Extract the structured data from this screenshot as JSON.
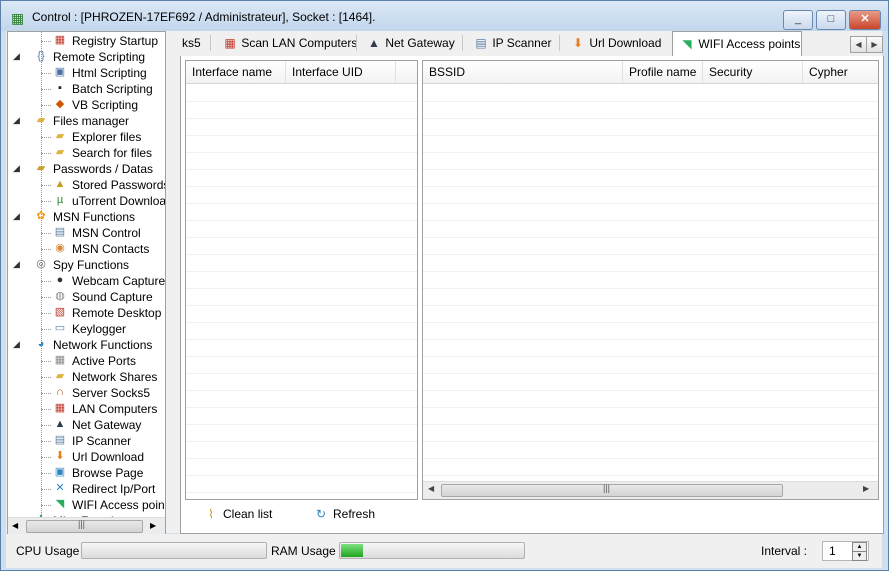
{
  "window": {
    "title": "Control : [PHROZEN-17EF692 / Administrateur], Socket : [1464].",
    "minimize": "_",
    "maximize": "□",
    "close": "✕"
  },
  "tree": {
    "items": [
      {
        "label": "Registry Startup",
        "level": 2,
        "icon": "toolbox-icon",
        "glyph": "▦",
        "color": "#c0392b"
      },
      {
        "label": "Remote Scripting",
        "level": 1,
        "icon": "code-icon",
        "glyph": "{}",
        "color": "#5b7fa6"
      },
      {
        "label": "Html Scripting",
        "level": 2,
        "icon": "html-doc-icon",
        "glyph": "▣",
        "color": "#4a6fa5"
      },
      {
        "label": "Batch Scripting",
        "level": 2,
        "icon": "terminal-icon",
        "glyph": "▪",
        "color": "#222"
      },
      {
        "label": "VB Scripting",
        "level": 2,
        "icon": "vb-icon",
        "glyph": "◆",
        "color": "#d35400"
      },
      {
        "label": "Files manager",
        "level": 1,
        "icon": "folder-icon",
        "glyph": "▰",
        "color": "#e0b040"
      },
      {
        "label": "Explorer files",
        "level": 2,
        "icon": "folder-open-icon",
        "glyph": "▰",
        "color": "#e0b040"
      },
      {
        "label": "Search for files",
        "level": 2,
        "icon": "folder-search-icon",
        "glyph": "▰",
        "color": "#e0b040"
      },
      {
        "label": "Passwords / Datas",
        "level": 1,
        "icon": "key-folder-icon",
        "glyph": "▰",
        "color": "#c9a030"
      },
      {
        "label": "Stored Passwords",
        "level": 2,
        "icon": "lock-icon",
        "glyph": "▲",
        "color": "#c99a20"
      },
      {
        "label": "uTorrent Download",
        "level": 2,
        "icon": "utorrent-icon",
        "glyph": "µ",
        "color": "#2e8b2e"
      },
      {
        "label": "MSN Functions",
        "level": 1,
        "icon": "msn-butterfly-icon",
        "glyph": "✿",
        "color": "#f39c12"
      },
      {
        "label": "MSN Control",
        "level": 2,
        "icon": "msn-window-icon",
        "glyph": "▤",
        "color": "#5b7fa6"
      },
      {
        "label": "MSN Contacts",
        "level": 2,
        "icon": "contacts-icon",
        "glyph": "◉",
        "color": "#d68b3a"
      },
      {
        "label": "Spy Functions",
        "level": 1,
        "icon": "fingerprint-icon",
        "glyph": "◎",
        "color": "#666"
      },
      {
        "label": "Webcam Capture",
        "level": 2,
        "icon": "webcam-icon",
        "glyph": "●",
        "color": "#333"
      },
      {
        "label": "Sound Capture",
        "level": 2,
        "icon": "microphone-icon",
        "glyph": "◍",
        "color": "#888"
      },
      {
        "label": "Remote Desktop",
        "level": 2,
        "icon": "remote-desktop-icon",
        "glyph": "▧",
        "color": "#c0392b"
      },
      {
        "label": "Keylogger",
        "level": 2,
        "icon": "keylogger-icon",
        "glyph": "▭",
        "color": "#5b7fa6"
      },
      {
        "label": "Network Functions",
        "level": 1,
        "icon": "globe-icon",
        "glyph": "◕",
        "color": "#2e86c1"
      },
      {
        "label": "Active Ports",
        "level": 2,
        "icon": "ports-icon",
        "glyph": "▦",
        "color": "#888"
      },
      {
        "label": "Network Shares",
        "level": 2,
        "icon": "shares-icon",
        "glyph": "▰",
        "color": "#e0b040"
      },
      {
        "label": "Server Socks5",
        "level": 2,
        "icon": "magnet-icon",
        "glyph": "∩",
        "color": "#c0392b"
      },
      {
        "label": "LAN Computers",
        "level": 2,
        "icon": "lan-icon",
        "glyph": "▦",
        "color": "#c0392b"
      },
      {
        "label": "Net Gateway",
        "level": 2,
        "icon": "gateway-icon",
        "glyph": "▲",
        "color": "#2c3e50"
      },
      {
        "label": "IP Scanner",
        "level": 2,
        "icon": "scanner-icon",
        "glyph": "▤",
        "color": "#5b7fa6"
      },
      {
        "label": "Url Download",
        "level": 2,
        "icon": "download-icon",
        "glyph": "⬇",
        "color": "#e67e22"
      },
      {
        "label": "Browse Page",
        "level": 2,
        "icon": "browse-icon",
        "glyph": "▣",
        "color": "#2e86c1"
      },
      {
        "label": "Redirect Ip/Port",
        "level": 2,
        "icon": "redirect-icon",
        "glyph": "✕",
        "color": "#2e86c1"
      },
      {
        "label": "WIFI Access points",
        "level": 2,
        "icon": "wifi-icon",
        "glyph": "◥",
        "color": "#27ae60"
      },
      {
        "label": "Misc Functions",
        "level": 1,
        "icon": "misc-icon",
        "glyph": "✚",
        "color": "#27ae60"
      }
    ]
  },
  "tabs": [
    {
      "label": "ks5",
      "icon": "",
      "glyph": ""
    },
    {
      "label": "Scan LAN Computers",
      "icon": "lan-icon",
      "glyph": "▦",
      "color": "#c0392b"
    },
    {
      "label": "Net Gateway",
      "icon": "gateway-icon",
      "glyph": "▲",
      "color": "#2c3e50"
    },
    {
      "label": "IP Scanner",
      "icon": "scanner-icon",
      "glyph": "▤",
      "color": "#5b7fa6"
    },
    {
      "label": "Url Download",
      "icon": "download-icon",
      "glyph": "⬇",
      "color": "#e67e22"
    },
    {
      "label": "WIFI Access points",
      "icon": "wifi-icon",
      "glyph": "◥",
      "color": "#27ae60",
      "active": true
    }
  ],
  "interfaces_table": {
    "columns": [
      "Interface name",
      "Interface UID"
    ]
  },
  "networks_table": {
    "columns": [
      "BSSID",
      "Profile name",
      "Security",
      "Cypher"
    ]
  },
  "actions": {
    "clean_list": "Clean list",
    "refresh": "Refresh"
  },
  "status": {
    "cpu_label": "CPU Usage :",
    "ram_label": "RAM Usage :",
    "cpu_usage": 0.0,
    "ram_usage": 0.12,
    "interval_label": "Interval :",
    "interval_value": "1"
  },
  "colors": {
    "accent": "#5a7fa8",
    "progress_fill": "#1ea51e"
  }
}
